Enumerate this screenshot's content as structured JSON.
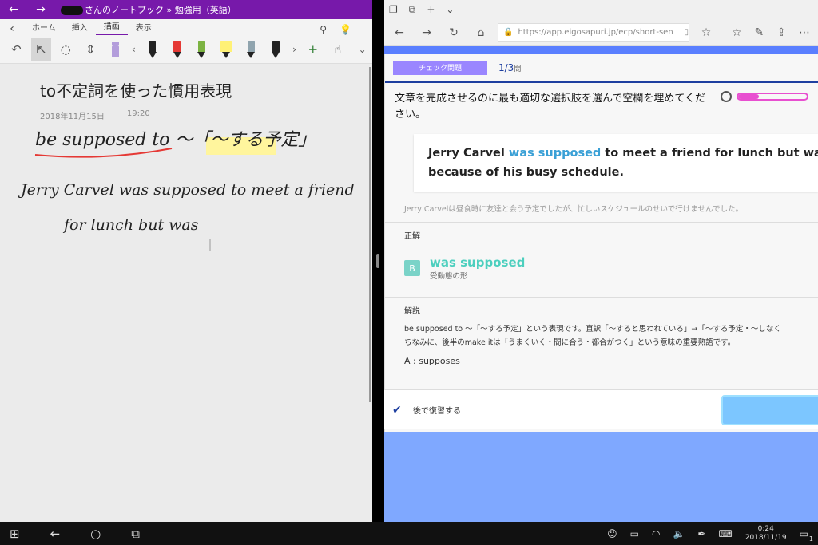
{
  "onenote": {
    "breadcrumb": "さんのノートブック » 勉強用（英語）",
    "tabs": [
      "ホーム",
      "挿入",
      "描画",
      "表示"
    ],
    "active_tab": "描画",
    "page_title": "to不定詞を使った慣用表現",
    "date": "2018年11月15日",
    "time": "19:20",
    "ink_line1": "be supposed to ～「～する予定」",
    "ink_line2": "Jerry Carvel was supposed to meet a friend",
    "ink_line3": "for lunch but was",
    "pen_colors": [
      "#b39ddb",
      "#222222",
      "#e53935",
      "#7cb342",
      "#fff176",
      "#90a4ae",
      "#222222"
    ]
  },
  "edge": {
    "url": "https://app.eigosapuri.jp/ecp/short-sen",
    "badge": "チェック問題",
    "question_count": "1/3",
    "question_unit": "問",
    "instruction": "文章を完成させるのに最も適切な選択肢を選んで空欄を埋めてください。",
    "timer_progress": 0.3,
    "sentence_before": "Jerry Carvel ",
    "sentence_highlight": "was supposed",
    "sentence_after": " to meet a friend for lunch but was una",
    "sentence_line2": "because of his busy schedule.",
    "translation": "Jerry Carvelは昼食時に友達と会う予定でしたが、忙しいスケジュールのせいで行けませんでした。",
    "correct_heading": "正解",
    "answer_letter": "B",
    "answer_text": "was supposed",
    "answer_sub": "受動態の形",
    "explanation_heading": "解説",
    "explanation_line1": "be supposed to ～「～する予定」という表現です。直訳「～すると思われている」→「～する予定・～しなく",
    "explanation_line2": "ちなみに、後半のmake itは「うまくいく・間に合う・都合がつく」という意味の重要熟語です。",
    "option_a": "A : supposes",
    "review_label": "後で復習する",
    "accent_color": "#3aa0d6",
    "answer_color": "#4ccfbe"
  },
  "taskbar": {
    "time": "0:24",
    "date": "2018/11/19",
    "notifications": "1"
  }
}
